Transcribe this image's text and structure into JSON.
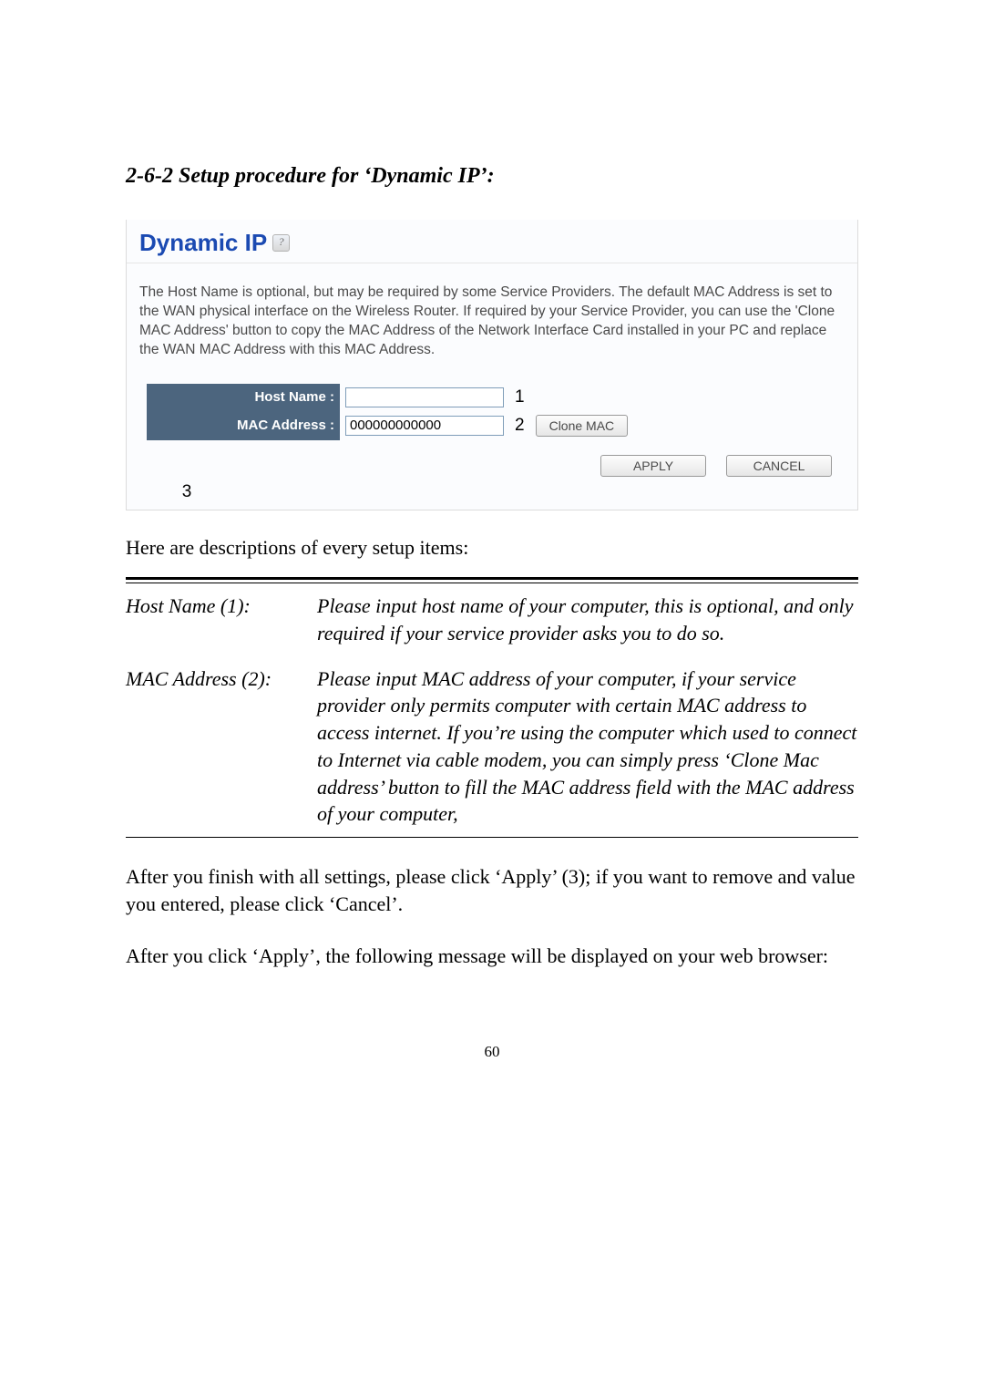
{
  "heading": "2-6-2 Setup procedure for ‘Dynamic IP’:",
  "panel": {
    "title": "Dynamic IP",
    "help_glyph": "?",
    "desc": "The Host Name is optional, but may be required by some Service Providers. The default MAC Address is set to the WAN physical interface on the Wireless Router. If required by your Service Provider, you can use the 'Clone MAC Address' button to copy the MAC Address of the Network Interface Card installed in your PC and replace the WAN MAC Address with this MAC Address.",
    "fields": {
      "hostname_label": "Host Name :",
      "hostname_value": "",
      "hostname_marker": "1",
      "mac_label": "MAC Address :",
      "mac_value": "000000000000",
      "mac_marker": "2",
      "clone_label": "Clone MAC"
    },
    "buttons": {
      "apply": "APPLY",
      "cancel": "CANCEL",
      "marker3": "3"
    }
  },
  "intro_line": "Here are descriptions of every setup items:",
  "table": {
    "row1": {
      "label": "Host Name (1):",
      "text": "Please input host name of your computer, this is optional, and only required if your service provider asks you to do so."
    },
    "row2": {
      "label": "MAC Address (2):",
      "text": "Please input MAC address of your computer, if your service provider only permits computer with certain MAC address to access internet. If you’re using the computer which used to connect to Internet via cable modem, you can simply press ‘Clone Mac address’ button to fill the MAC address field with the MAC address of your computer,"
    }
  },
  "para1": "After you finish with all settings, please click ‘Apply’ (3); if you want to remove and value you entered, please click ‘Cancel’.",
  "para2": "After you click ‘Apply’, the following message will be displayed on your web browser:",
  "page_number": "60"
}
